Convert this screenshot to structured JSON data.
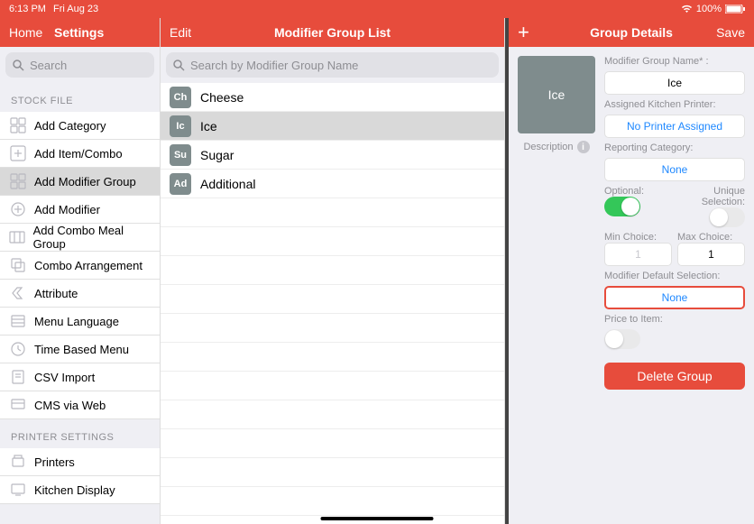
{
  "status": {
    "time": "6:13 PM",
    "date": "Fri Aug 23",
    "battery": "100%"
  },
  "col1": {
    "home": "Home",
    "settings": "Settings",
    "search_ph": "Search",
    "sec1": "STOCK FILE",
    "items1": [
      "Add Category",
      "Add Item/Combo",
      "Add Modifier Group",
      "Add Modifier",
      "Add Combo Meal Group",
      "Combo Arrangement",
      "Attribute",
      "Menu Language",
      "Time Based Menu",
      "CSV Import",
      "CMS via Web"
    ],
    "sec2": "PRINTER SETTINGS",
    "items2": [
      "Printers",
      "Kitchen Display"
    ]
  },
  "col2": {
    "edit": "Edit",
    "title": "Modifier Group List",
    "search_ph": "Search by Modifier Group Name",
    "groups": [
      {
        "abbr": "Ch",
        "name": "Cheese"
      },
      {
        "abbr": "Ic",
        "name": "Ice"
      },
      {
        "abbr": "Su",
        "name": "Sugar"
      },
      {
        "abbr": "Ad",
        "name": "Additional"
      }
    ]
  },
  "col3": {
    "title": "Group Details",
    "save": "Save",
    "plus": "+",
    "thumb": "Ice",
    "description": "Description",
    "name_lbl": "Modifier Group Name* :",
    "name_val": "Ice",
    "printer_lbl": "Assigned Kitchen Printer:",
    "printer_val": "No Printer Assigned",
    "cat_lbl": "Reporting Category:",
    "cat_val": "None",
    "opt_lbl": "Optional:",
    "uniq_lbl": "Unique Selection:",
    "min_lbl": "Min Choice:",
    "min_val": "1",
    "max_lbl": "Max Choice:",
    "max_val": "1",
    "def_lbl": "Modifier Default Selection:",
    "def_val": "None",
    "price_lbl": "Price to Item:",
    "delete": "Delete Group"
  }
}
